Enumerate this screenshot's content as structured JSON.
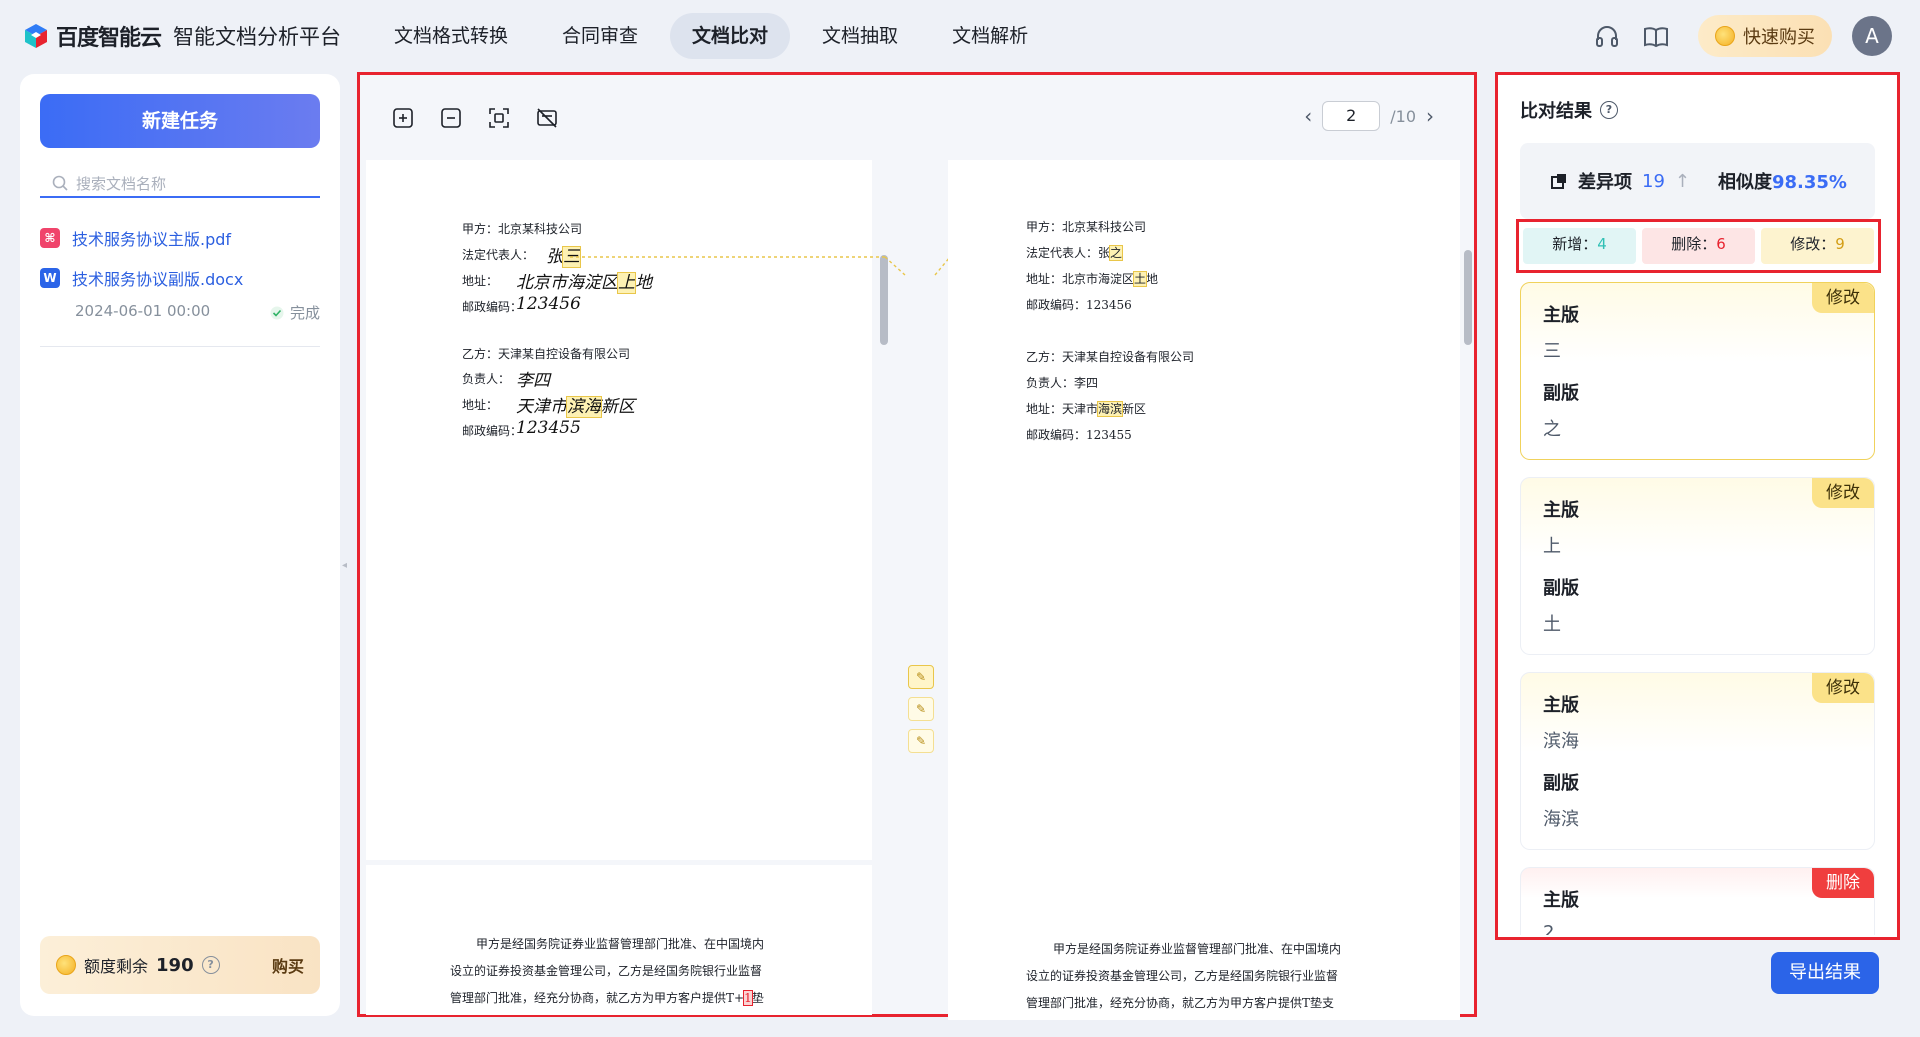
{
  "header": {
    "brand": "百度智能云",
    "product": "智能文档分析平台",
    "nav": [
      {
        "label": "文档格式转换"
      },
      {
        "label": "合同审查"
      },
      {
        "label": "文档比对"
      },
      {
        "label": "文档抽取"
      },
      {
        "label": "文档解析"
      }
    ],
    "active_nav": "文档比对",
    "quick_buy": "快速购买",
    "avatar_initial": "A"
  },
  "sidebar": {
    "new_task": "新建任务",
    "search_placeholder": "搜索文档名称",
    "files": [
      {
        "name": "技术服务协议主版.pdf",
        "type": "pdf"
      },
      {
        "name": "技术服务协议副版.docx",
        "type": "word"
      }
    ],
    "task_time": "2024-06-01 00:00",
    "task_status": "完成",
    "quota_label": "额度剩余",
    "quota_value": "190",
    "quota_buy": "购买"
  },
  "viewer": {
    "page_current": "2",
    "page_total": "/10",
    "left_doc": {
      "party_a": "甲方：北京某科技公司",
      "legal_rep_label": "法定代表人：",
      "legal_rep_value_1": "张",
      "legal_rep_value_2": "三",
      "address_label": "地址：",
      "address_value_1": "北京市海淀区",
      "address_value_2": "上",
      "address_value_3": "地",
      "postcode_label": "邮政编码：",
      "postcode_value": "123456",
      "party_b": "乙方：天津某自控设备有限公司",
      "owner_label": "负责人：",
      "owner_value": "李四",
      "b_address_label": "地址：",
      "b_address_value_1": "天津市",
      "b_address_value_2": "滨海",
      "b_address_value_3": "新区",
      "b_postcode_label": "邮政编码：",
      "b_postcode_value": "123455",
      "para_1": "甲方是经国务院证券业监督管理部门批准、在中国境内",
      "para_2": "设立的证券投资基金管理公司，乙方是经国务院银行业监督",
      "para_3a": "管理部门批准，经充分协商，就乙方为甲方客户提供T+",
      "para_3b": "1",
      "para_3c": "垫"
    },
    "right_doc": {
      "party_a": "甲方：北京某科技公司",
      "legal_rep_1": "法定代表人：张",
      "legal_rep_2": "之",
      "address_1": "地址：北京市海淀区",
      "address_2": "土",
      "address_3": "地",
      "postcode": "邮政编码：123456",
      "party_b": "乙方：天津某自控设备有限公司",
      "owner": "负责人：李四",
      "b_address_1": "地址：天津市",
      "b_address_2": "海滨",
      "b_address_3": "新区",
      "b_postcode": "邮政编码：123455",
      "para_1": "甲方是经国务院证券业监督管理部门批准、在中国境内",
      "para_2": "设立的证券投资基金管理公司，乙方是经国务院银行业监督",
      "para_3": "管理部门批准，经充分协商，就乙方为甲方客户提供T垫支"
    }
  },
  "results": {
    "title": "比对结果",
    "diff_label": "差异项",
    "diff_count": "19",
    "similarity_label": "相似度",
    "similarity_value": "98.35%",
    "stats": {
      "add_label": "新增：",
      "add_value": "4",
      "del_label": "删除：",
      "del_value": "6",
      "mod_label": "修改：",
      "mod_value": "9"
    },
    "main_label": "主版",
    "sub_label": "副版",
    "cards": [
      {
        "tag": "修改",
        "main": "三",
        "sub": "之"
      },
      {
        "tag": "修改",
        "main": "上",
        "sub": "土"
      },
      {
        "tag": "修改",
        "main": "滨海",
        "sub": "海滨"
      },
      {
        "tag": "删除",
        "main": "2"
      }
    ],
    "export": "导出结果"
  }
}
